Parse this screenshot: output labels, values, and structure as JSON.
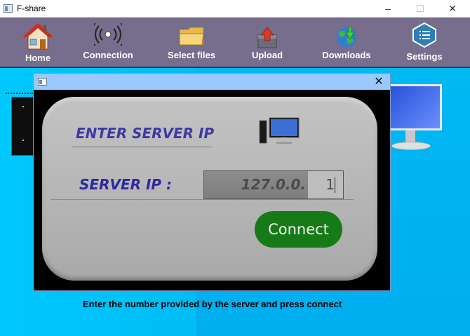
{
  "window": {
    "title": "F-share",
    "controls": [
      "–",
      "✕"
    ]
  },
  "toolbar": {
    "items": [
      {
        "label": "Home",
        "icon": "home-icon"
      },
      {
        "label": "Connection",
        "icon": "signal-icon"
      },
      {
        "label": "Select files",
        "icon": "folder-icon"
      },
      {
        "label": "Upload",
        "icon": "upload-icon"
      },
      {
        "label": "Downloads",
        "icon": "download-globe-icon"
      },
      {
        "label": "Settings",
        "icon": "settings-hexagon-icon"
      }
    ]
  },
  "dialog": {
    "close": "✕",
    "heading": "ENTER SERVER IP",
    "ip_label": "SERVER IP :",
    "ip_value_prefix": "127.0.0.",
    "ip_value_suffix": "1",
    "connect_label": "Connect"
  },
  "instruction": "Enter the number provided by the server and press connect",
  "colors": {
    "toolbar": "#766e8c",
    "background": "#00bdf5",
    "panel": "#b8b8b8",
    "accent_text": "#3f3aa4",
    "connect_button": "#167a16"
  }
}
